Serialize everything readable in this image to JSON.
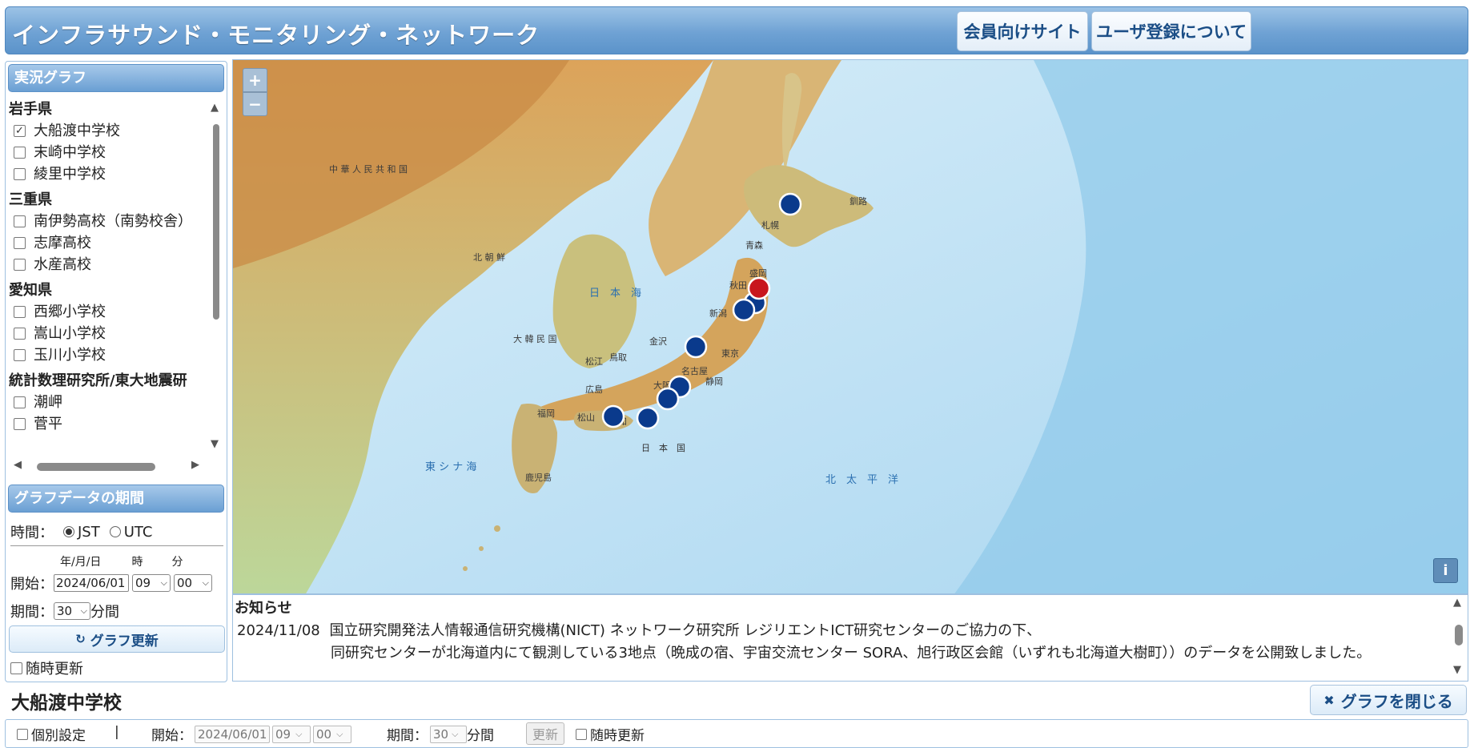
{
  "header": {
    "title": "インフラサウンド・モニタリング・ネットワーク",
    "member_site": "会員向けサイト",
    "user_registration": "ユーザ登録について"
  },
  "live_graph": {
    "heading": "実況グラフ",
    "groups": [
      {
        "name": "岩手県",
        "stations": [
          {
            "label": "大船渡中学校",
            "checked": true
          },
          {
            "label": "末崎中学校",
            "checked": false
          },
          {
            "label": "綾里中学校",
            "checked": false
          }
        ]
      },
      {
        "name": "三重県",
        "stations": [
          {
            "label": "南伊勢高校（南勢校舎）",
            "checked": false
          },
          {
            "label": "志摩高校",
            "checked": false
          },
          {
            "label": "水産高校",
            "checked": false
          }
        ]
      },
      {
        "name": "愛知県",
        "stations": [
          {
            "label": "西郷小学校",
            "checked": false
          },
          {
            "label": "嵩山小学校",
            "checked": false
          },
          {
            "label": "玉川小学校",
            "checked": false
          }
        ]
      },
      {
        "name": "統計数理研究所/東大地震研",
        "stations": [
          {
            "label": "潮岬",
            "checked": false
          },
          {
            "label": "菅平",
            "checked": false
          }
        ]
      }
    ]
  },
  "period": {
    "heading": "グラフデータの期間",
    "time_label": "時間：",
    "jst": "JST",
    "utc": "UTC",
    "col_date": "年/月/日",
    "col_hour": "時",
    "col_min": "分",
    "start_label": "開始：",
    "start_date": "2024/06/01",
    "start_hour": "09",
    "start_min": "00",
    "duration_label": "期間：",
    "duration": "30",
    "duration_unit": "分間",
    "update_button": "グラフ更新",
    "auto_update": "随時更新"
  },
  "map": {
    "zoom_in": "+",
    "zoom_out": "−",
    "info": "i",
    "labels": {
      "china": "中 華 人 民 共 和 国",
      "nk": "北 朝 鮮",
      "korea": "大 韓 民 国",
      "sea_japan": "日　本　海",
      "east_china_sea": "東 シ ナ 海",
      "pacific": "北　太　平　洋",
      "japan": "日　本　国",
      "sapporo": "札幌",
      "akita": "秋田",
      "morioka": "盛岡",
      "sendai": "仙台",
      "niigata": "新潟",
      "kanazawa": "金沢",
      "tokyo": "東京",
      "nagoya": "名古屋",
      "osaka": "大阪",
      "hiroshima": "広島",
      "fukuoka": "福岡",
      "kagoshima": "鹿児島",
      "shizuoka": "静岡",
      "matsuyama": "松山",
      "kochi": "高知",
      "tottori": "鳥取",
      "matsue": "松江",
      "aomori": "青森",
      "kushiro": "釧路"
    },
    "colors": {
      "station": "#0a3a8c",
      "selected": "#c8161d",
      "sea": "#cfe8f6",
      "land": "#e9c98a"
    }
  },
  "notice": {
    "title": "お知らせ",
    "date": "2024/11/08",
    "line1": "国立研究開発法人情報通信研究機構(NICT) ネットワーク研究所 レジリエントICT研究センターのご協力の下、",
    "line2": "同研究センターが北海道内にて観測している3地点（晩成の宿、宇宙交流センター SORA、旭行政区会館（いずれも北海道大樹町））のデータを公開致しました。"
  },
  "graph": {
    "title": "大船渡中学校",
    "close_button": "グラフを閉じる",
    "individual_setting": "個別設定",
    "separator": "|",
    "start_label": "開始：",
    "start_date": "2024/06/01",
    "start_hour": "09",
    "start_min": "00",
    "duration_label": "期間：",
    "duration": "30",
    "duration_unit": "分間",
    "update_button": "更新",
    "auto_update": "随時更新"
  }
}
